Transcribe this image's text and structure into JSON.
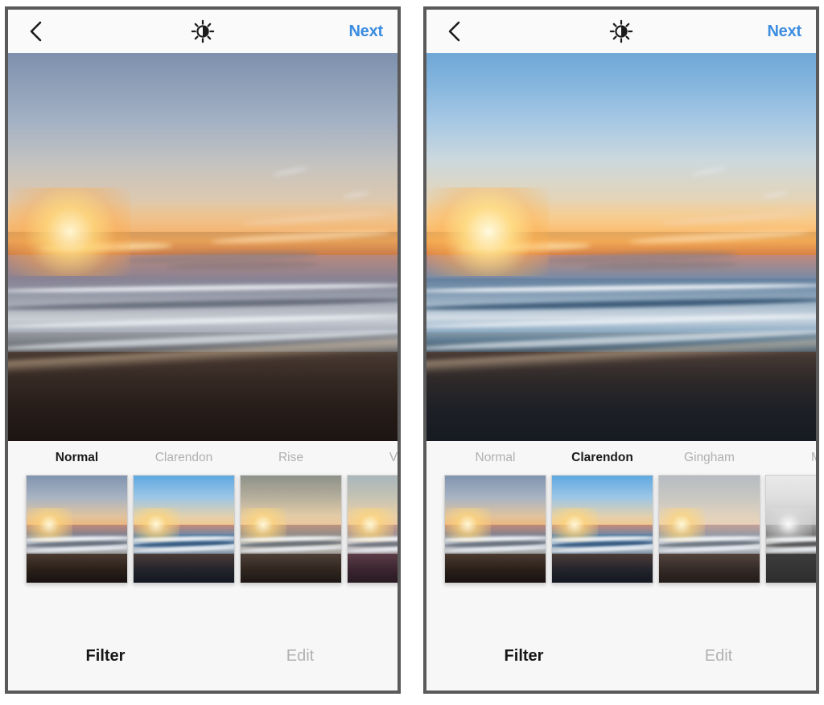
{
  "panels": [
    {
      "id": "left-panel",
      "variant": "normal",
      "navbar": {
        "back_icon": "chevron-left-icon",
        "center_icon": "brightness-sun-icon",
        "next_label": "Next",
        "next_color": "#3c8ce0"
      },
      "photo": {
        "alt": "beach-sunset-photo",
        "applied_filter": "Normal"
      },
      "filters": [
        {
          "name": "Normal",
          "selected": true,
          "skin": "sk-normal"
        },
        {
          "name": "Clarendon",
          "selected": false,
          "skin": "sk-clarendon"
        },
        {
          "name": "Rise",
          "selected": false,
          "skin": "sk-rise"
        },
        {
          "name": "Val",
          "selected": false,
          "skin": "sk-valencia"
        }
      ],
      "tabs": [
        {
          "label": "Filter",
          "active": true
        },
        {
          "label": "Edit",
          "active": false
        }
      ]
    },
    {
      "id": "right-panel",
      "variant": "clarendon",
      "navbar": {
        "back_icon": "chevron-left-icon",
        "center_icon": "brightness-sun-icon",
        "next_label": "Next",
        "next_color": "#3c8ce0"
      },
      "photo": {
        "alt": "beach-sunset-photo",
        "applied_filter": "Clarendon"
      },
      "filters": [
        {
          "name": "Normal",
          "selected": false,
          "skin": "sk-normal"
        },
        {
          "name": "Clarendon",
          "selected": true,
          "skin": "sk-clarendon"
        },
        {
          "name": "Gingham",
          "selected": false,
          "skin": "sk-gingham"
        },
        {
          "name": "M",
          "selected": false,
          "skin": "sk-moon"
        }
      ],
      "tabs": [
        {
          "label": "Filter",
          "active": true
        },
        {
          "label": "Edit",
          "active": false
        }
      ]
    }
  ],
  "colors": {
    "accent_blue": "#3c8ce0",
    "chrome_bg": "#f7f7f7",
    "frame_border": "#5a5a5a",
    "label_inactive": "#b0b0b0",
    "label_active": "#1b1b1b"
  }
}
